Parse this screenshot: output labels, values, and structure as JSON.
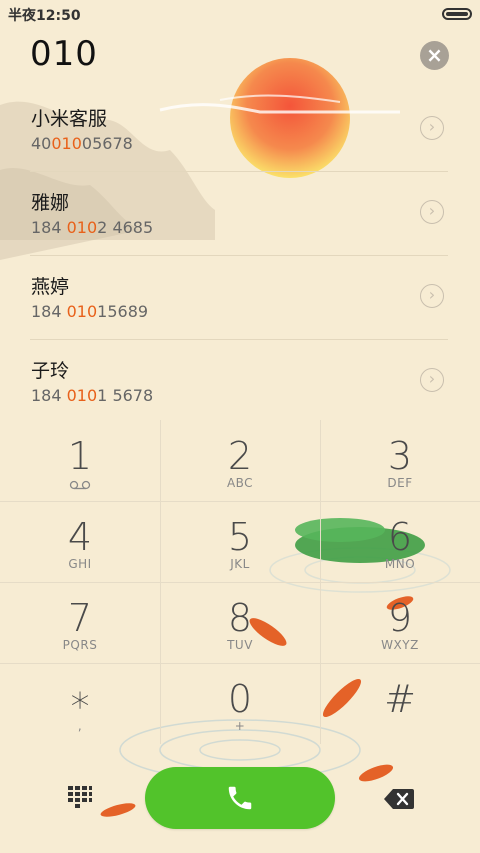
{
  "status": {
    "time": "半夜12:50"
  },
  "dialer": {
    "number": "010"
  },
  "contacts": [
    {
      "name": "小米客服",
      "phone_pre": "40",
      "phone_match": "010",
      "phone_post": "05678"
    },
    {
      "name": "雅娜",
      "phone_pre": "184 ",
      "phone_match": "010",
      "phone_post": "2 4685"
    },
    {
      "name": "燕婷",
      "phone_pre": "184 ",
      "phone_match": "010",
      "phone_post": "15689"
    },
    {
      "name": "子玲",
      "phone_pre": "184 ",
      "phone_match": "010",
      "phone_post": "1 5678"
    }
  ],
  "keys": [
    {
      "digit": "1",
      "letters": ""
    },
    {
      "digit": "2",
      "letters": "ABC"
    },
    {
      "digit": "3",
      "letters": "DEF"
    },
    {
      "digit": "4",
      "letters": "GHI"
    },
    {
      "digit": "5",
      "letters": "JKL"
    },
    {
      "digit": "6",
      "letters": "MNO"
    },
    {
      "digit": "7",
      "letters": "PQRS"
    },
    {
      "digit": "8",
      "letters": "TUV"
    },
    {
      "digit": "9",
      "letters": "WXYZ"
    },
    {
      "digit": "∗",
      "letters": ","
    },
    {
      "digit": "0",
      "letters": "+"
    },
    {
      "digit": "#",
      "letters": ""
    }
  ],
  "colors": {
    "accent": "#52c32b",
    "highlight": "#e8611a",
    "background": "#f7ecd3"
  },
  "icons": [
    "voicemail-icon",
    "clear-icon",
    "chevron-right-icon",
    "keypad-grid-icon",
    "phone-icon",
    "backspace-icon"
  ]
}
